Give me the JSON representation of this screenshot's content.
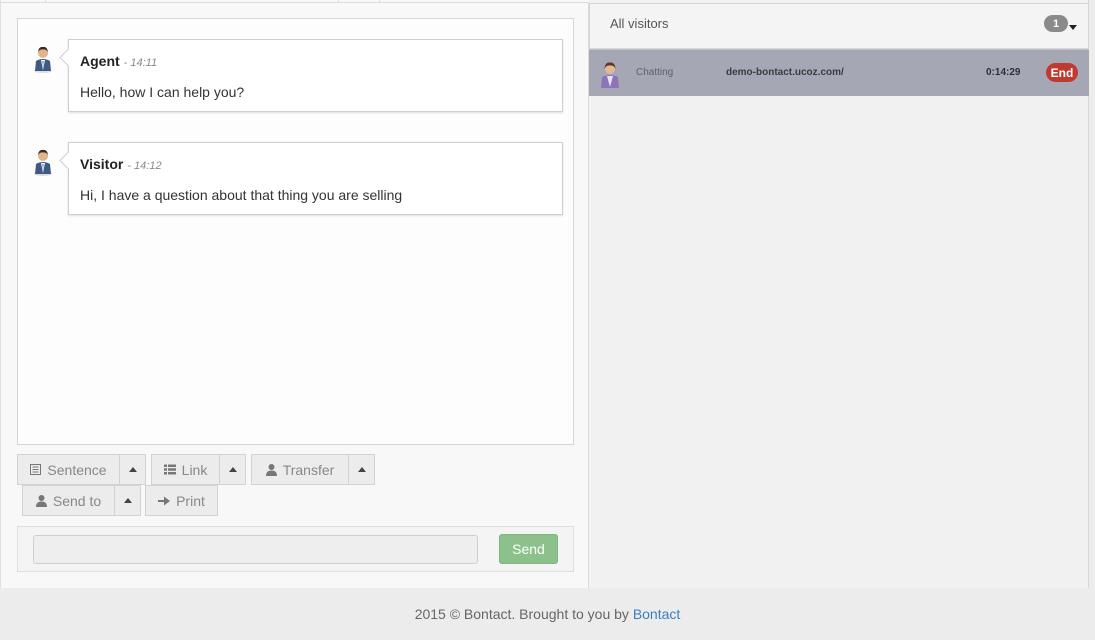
{
  "chat": {
    "messages": [
      {
        "sender": "Agent",
        "time": "- 14:11",
        "text": "Hello, how I can help you?"
      },
      {
        "sender": "Visitor",
        "time": "- 14:12",
        "text": "Hi, I have a question about that thing you are selling"
      }
    ]
  },
  "toolbar": {
    "sentence_label": "Sentence",
    "link_label": "Link",
    "transfer_label": "Transfer",
    "send_to_label": "Send to",
    "print_label": "Print"
  },
  "composer": {
    "input_value": "",
    "send_label": "Send"
  },
  "visitors_panel": {
    "title": "All visitors",
    "count": "1",
    "rows": [
      {
        "status": "Chatting",
        "url": "demo-bontact.ucoz.com/",
        "duration": "0:14:29",
        "end_label": "End"
      }
    ]
  },
  "footer": {
    "text": "2015 © Bontact. Brought to you by",
    "link_text": "Bontact"
  },
  "colors": {
    "send_button": "#8cc18c",
    "end_badge": "#c0392f",
    "active_row": "#a5a8b4",
    "link": "#3a7fc1"
  },
  "icons": {
    "sentence": "list-doc-icon",
    "link": "list-icon",
    "transfer": "user-icon",
    "send_to": "user-icon",
    "print": "arrow-right-icon"
  }
}
